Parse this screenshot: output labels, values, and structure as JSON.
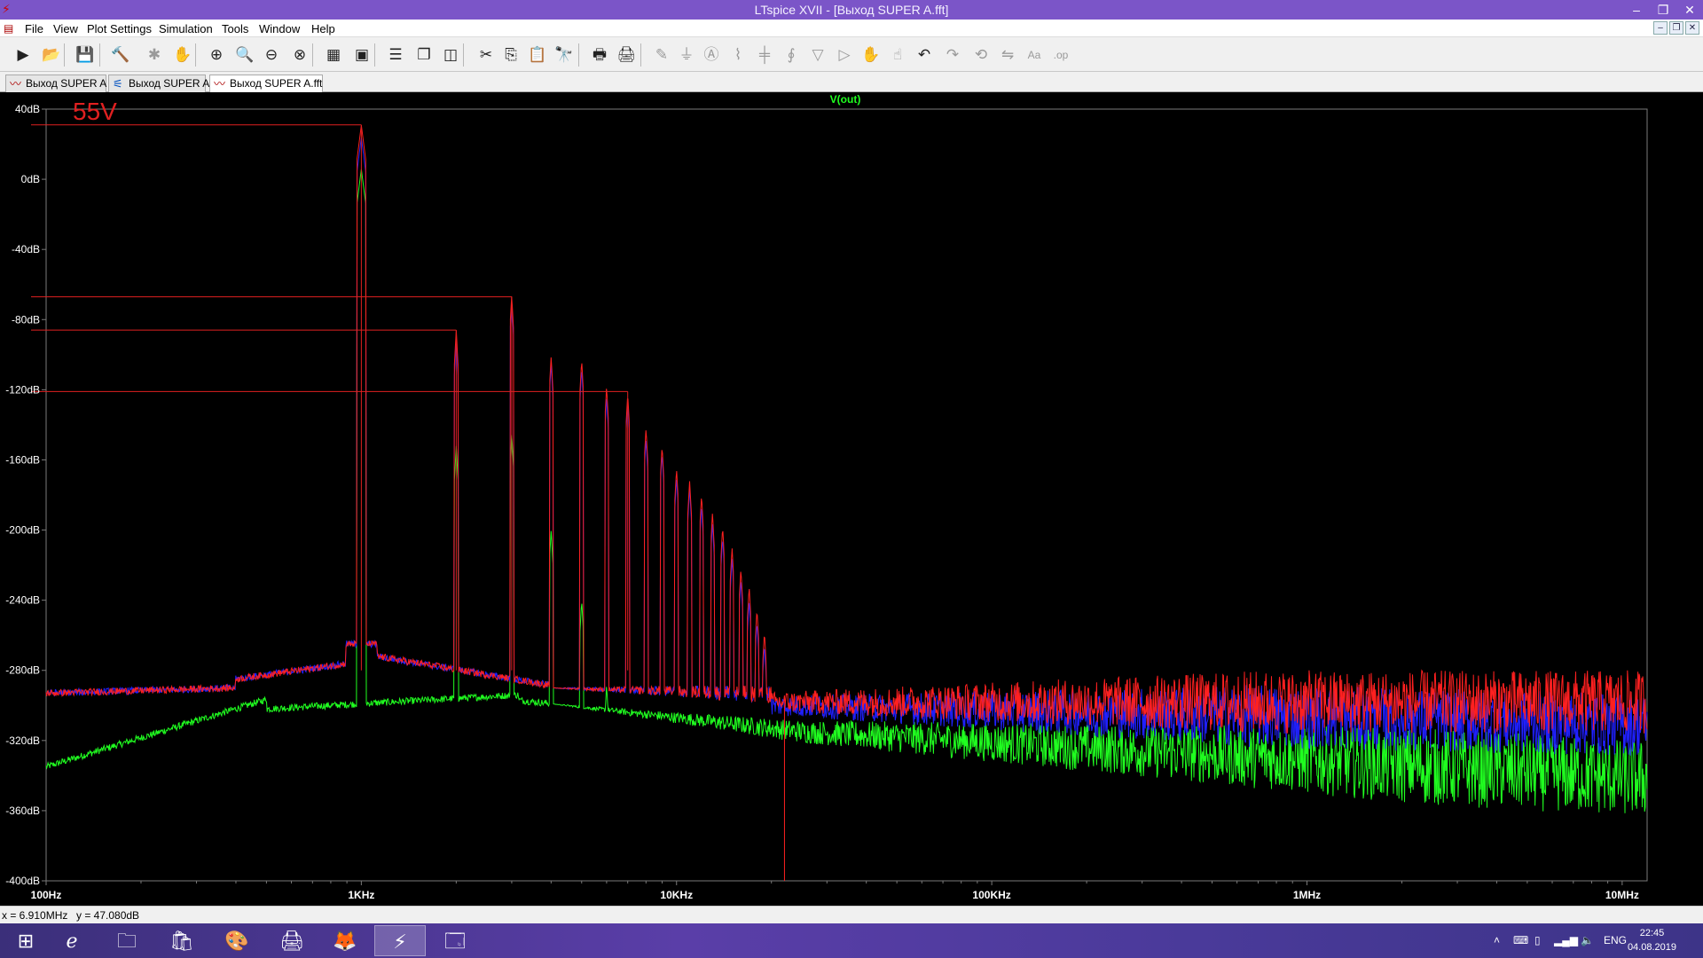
{
  "window": {
    "title": "LTspice XVII - [Выход SUPER A.fft]"
  },
  "menu": [
    "File",
    "View",
    "Plot Settings",
    "Simulation",
    "Tools",
    "Window",
    "Help"
  ],
  "toolbar": [
    {
      "name": "run-icon",
      "glyph": "▶"
    },
    {
      "name": "open-icon",
      "glyph": "📂"
    },
    {
      "name": "save-icon",
      "glyph": "💾"
    },
    {
      "name": "control-panel-icon",
      "glyph": "🔨"
    },
    {
      "name": "halt-icon",
      "glyph": "✱"
    },
    {
      "name": "pan-icon",
      "glyph": "✋"
    },
    {
      "name": "zoom-in-icon",
      "glyph": "⊕"
    },
    {
      "name": "zoom-area-icon",
      "glyph": "🔍"
    },
    {
      "name": "zoom-out-icon",
      "glyph": "⊖"
    },
    {
      "name": "zoom-full-icon",
      "glyph": "⊗"
    },
    {
      "name": "autorange-icon",
      "glyph": "▦"
    },
    {
      "name": "view-fit-icon",
      "glyph": "▣"
    },
    {
      "name": "tile-horizontal-icon",
      "glyph": "☰"
    },
    {
      "name": "cascade-icon",
      "glyph": "❐"
    },
    {
      "name": "tile-vertical-icon",
      "glyph": "◫"
    },
    {
      "name": "cut-icon",
      "glyph": "✂"
    },
    {
      "name": "copy-icon",
      "glyph": "⎘"
    },
    {
      "name": "paste-icon",
      "glyph": "📋"
    },
    {
      "name": "find-icon",
      "glyph": "🔭"
    },
    {
      "name": "print-icon",
      "glyph": "🖶"
    },
    {
      "name": "print-setup-icon",
      "glyph": "🖨"
    },
    {
      "name": "wire-icon",
      "glyph": "✎"
    },
    {
      "name": "ground-icon",
      "glyph": "⏚"
    },
    {
      "name": "label-icon",
      "glyph": "Ⓐ"
    },
    {
      "name": "resistor-icon",
      "glyph": "⌇"
    },
    {
      "name": "capacitor-icon",
      "glyph": "╪"
    },
    {
      "name": "inductor-icon",
      "glyph": "∮"
    },
    {
      "name": "diode-icon",
      "glyph": "▽"
    },
    {
      "name": "component-icon",
      "glyph": "▷"
    },
    {
      "name": "move-icon",
      "glyph": "✋"
    },
    {
      "name": "drag-icon",
      "glyph": "☝"
    },
    {
      "name": "undo-icon",
      "glyph": "↶"
    },
    {
      "name": "redo-icon",
      "glyph": "↷"
    },
    {
      "name": "rotate-icon",
      "glyph": "⟲"
    },
    {
      "name": "mirror-icon",
      "glyph": "⇋"
    },
    {
      "name": "text-icon",
      "glyph": "Aa"
    },
    {
      "name": "spice-directive-icon",
      "glyph": ".op"
    }
  ],
  "tabs": [
    {
      "label": "Выход SUPER A",
      "icon": "waveform-icon",
      "active": false
    },
    {
      "label": "Выход SUPER A",
      "icon": "schematic-icon",
      "active": false
    },
    {
      "label": "Выход SUPER A.fft",
      "icon": "fft-icon",
      "active": true
    }
  ],
  "plot": {
    "trace_label": "V(out)",
    "annotation": "55V"
  },
  "chart_data": {
    "type": "line",
    "title": "V(out)",
    "xscale": "log",
    "xlim": [
      100,
      12000000
    ],
    "ylim": [
      -400,
      40
    ],
    "x_ticks": [
      "100Hz",
      "1KHz",
      "10KHz",
      "100KHz",
      "1MHz",
      "10MHz"
    ],
    "y_ticks": [
      "40dB",
      "0dB",
      "-40dB",
      "-80dB",
      "-120dB",
      "-160dB",
      "-200dB",
      "-240dB",
      "-280dB",
      "-320dB",
      "-360dB",
      "-400dB"
    ],
    "colors": {
      "red": "#ff2020",
      "blue": "#2020ff",
      "green": "#20ff20",
      "grid": "#7a7a7a"
    },
    "harmonics": {
      "fundamental_hz": 1000,
      "red": [
        31,
        -86,
        -66,
        -101,
        -103,
        -118,
        -122,
        -142,
        -152,
        -165,
        -172,
        -180,
        -190,
        -198,
        -210,
        -222,
        -232,
        -245,
        -258
      ],
      "blue": [
        24,
        -92,
        -70,
        -105,
        -108,
        -124,
        -126,
        -148,
        -156,
        -170,
        -176,
        -186,
        -196,
        -204,
        -216,
        -228,
        -240,
        -252,
        -265
      ],
      "green": [
        6,
        -152,
        -145,
        -200,
        -240,
        -288
      ]
    },
    "markers": [
      {
        "level_db": 31,
        "x_hz": 1000
      },
      {
        "level_db": -67,
        "x_hz": 3000
      },
      {
        "level_db": -86,
        "x_hz": 2000
      },
      {
        "level_db": -121,
        "x_hz": 7000
      }
    ]
  },
  "status": {
    "x": "x = 6.910MHz",
    "y": "y = 47.080dB"
  },
  "taskbar": {
    "apps": [
      {
        "name": "start-icon",
        "glyph": "⊞"
      },
      {
        "name": "internet-explorer-icon",
        "glyph": "ℯ"
      },
      {
        "name": "file-explorer-icon",
        "glyph": "🗀"
      },
      {
        "name": "store-icon",
        "glyph": "🛍"
      },
      {
        "name": "paint-icon",
        "glyph": "🎨"
      },
      {
        "name": "printer-app-icon",
        "glyph": "🖨"
      },
      {
        "name": "firefox-icon",
        "glyph": "🦊"
      },
      {
        "name": "ltspice-icon",
        "glyph": "⚡"
      },
      {
        "name": "window-app-icon",
        "glyph": "🗔"
      }
    ],
    "lang": "ENG",
    "time": "22:45",
    "date": "04.08.2019"
  }
}
